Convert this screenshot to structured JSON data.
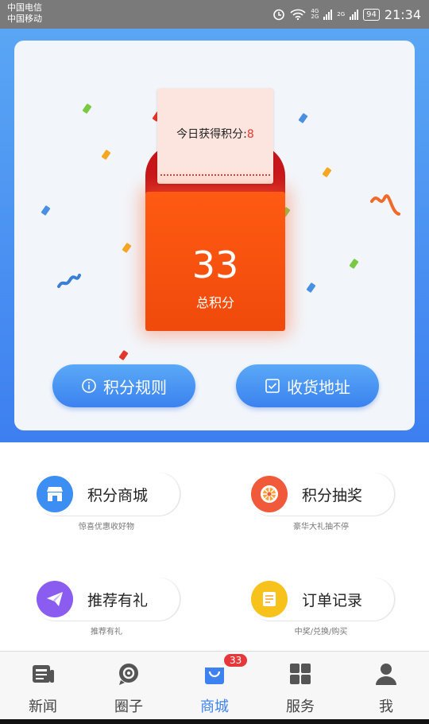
{
  "status_bar": {
    "carrier_1": "中国电信",
    "carrier_2": "中国移动",
    "battery": "94",
    "time": "21:34",
    "network_1": "4G",
    "network_2": "2G"
  },
  "points": {
    "today_label": "今日获得积分:",
    "today_value": "8",
    "total_value": "33",
    "total_label": "总积分"
  },
  "buttons": {
    "rules": "积分规则",
    "address": "收货地址"
  },
  "services": [
    {
      "label": "积分商城",
      "sub": "惊喜优惠收好物",
      "icon": "store-icon",
      "color": "#3d8ef2"
    },
    {
      "label": "积分抽奖",
      "sub": "豪华大礼抽不停",
      "icon": "wheel-icon",
      "color": "#f05a3a"
    },
    {
      "label": "推荐有礼",
      "sub": "推荐有礼",
      "icon": "paper-plane-icon",
      "color": "#8b5cf0"
    },
    {
      "label": "订单记录",
      "sub": "中奖/兑换/购买",
      "icon": "order-icon",
      "color": "#f7c21c"
    }
  ],
  "tabs": [
    {
      "label": "新闻",
      "icon": "news-icon"
    },
    {
      "label": "圈子",
      "icon": "circle-icon"
    },
    {
      "label": "商城",
      "icon": "shopping-bag-icon",
      "badge": "33"
    },
    {
      "label": "服务",
      "icon": "grid-icon"
    },
    {
      "label": "我",
      "icon": "user-icon"
    }
  ],
  "colors": {
    "accent": "#3d82f0",
    "envelope": "#f04a0c",
    "badge": "#e6373a"
  }
}
